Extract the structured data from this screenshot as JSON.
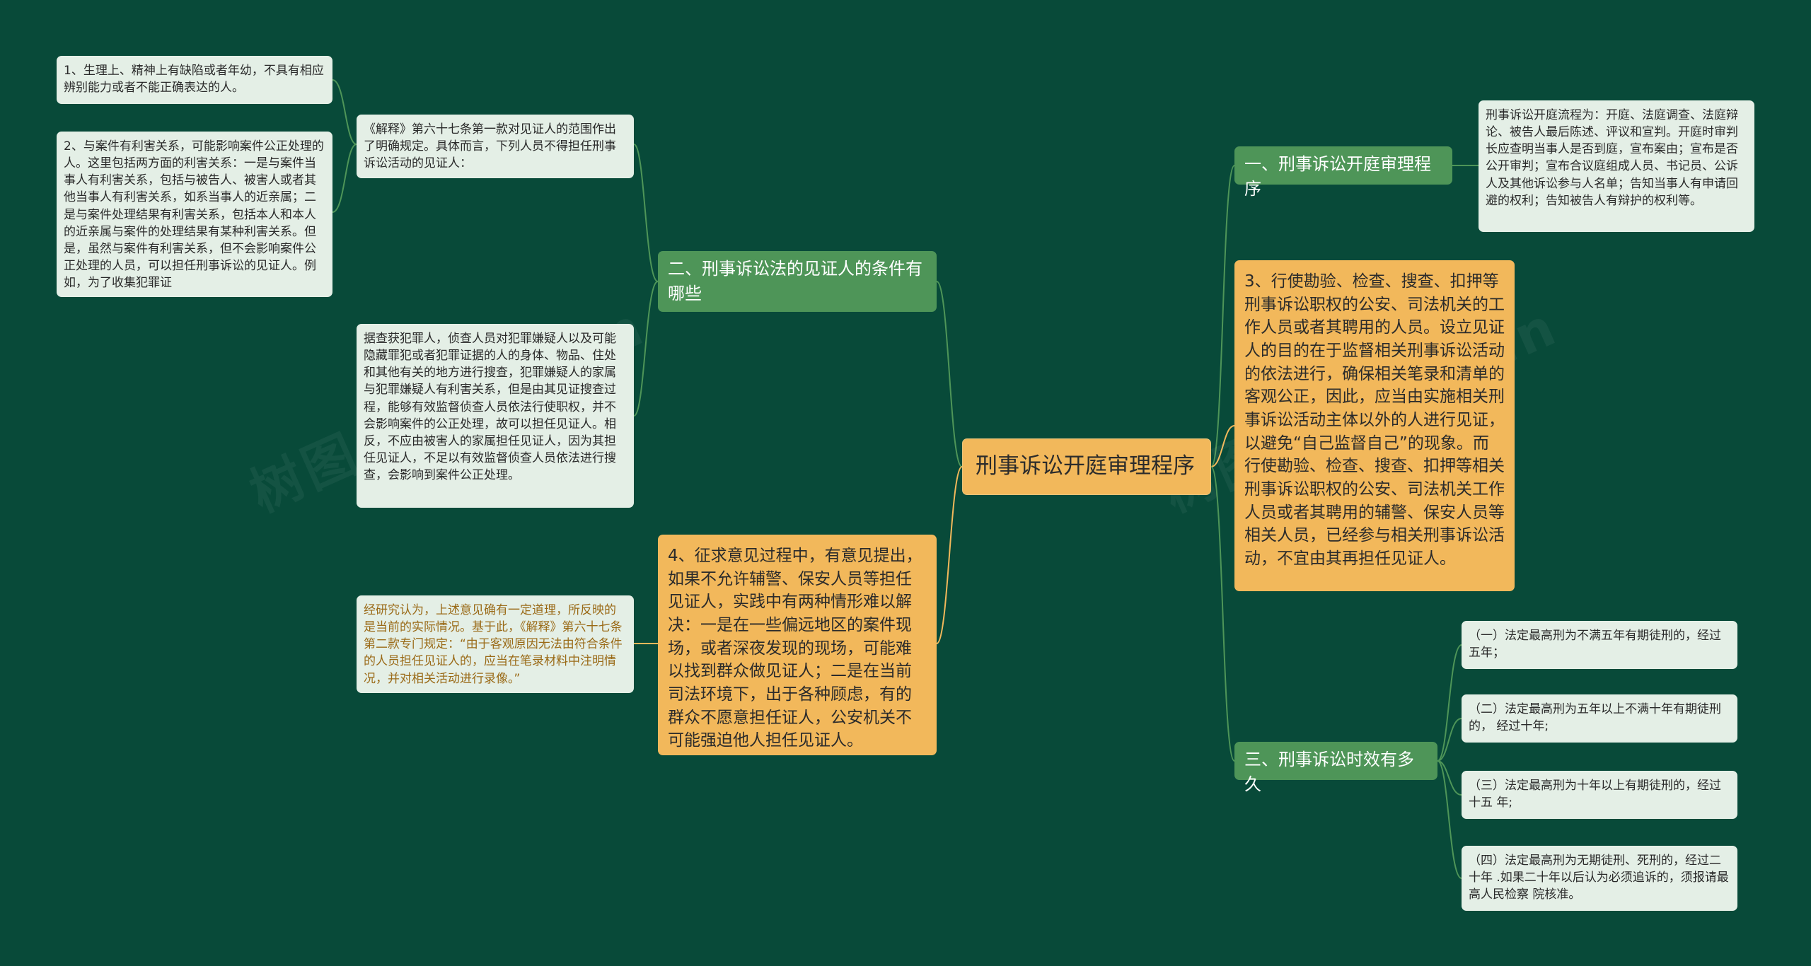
{
  "root": {
    "label": "刑事诉讼开庭审理程序"
  },
  "branches": {
    "b1": {
      "label": "一、刑事诉讼开庭审理程序"
    },
    "b2": {
      "label": "二、刑事诉讼法的见证人的条件有哪些"
    },
    "b3": {
      "label": "三、刑事诉讼时效有多久"
    },
    "b4": {
      "label": "3、行使勘验、检查、搜查、扣押等刑事诉讼职权的公安、司法机关的工作人员或者其聘用的人员。设立见证人的目的在于监督相关刑事诉讼活动的依法进行，确保相关笔录和清单的客观公正，因此，应当由实施相关刑事诉讼活动主体以外的人进行见证，以避免“自己监督自己”的现象。而行使勘验、检查、搜查、扣押等相关刑事诉讼职权的公安、司法机关工作人员或者其聘用的辅警、保安人员等相关人员，已经参与相关刑事诉讼活动，不宜由其再担任见证人。"
    },
    "b5": {
      "label": "4、征求意见过程中，有意见提出，如果不允许辅警、保安人员等担任见证人，实践中有两种情形难以解决：一是在一些偏远地区的案件现场，或者深夜发现的现场，可能难以找到群众做见证人；二是在当前司法环境下，出于各种顾虑，有的群众不愿意担任证人，公安机关不可能强迫他人担任见证人。"
    }
  },
  "leaves": {
    "procedure": "刑事诉讼开庭流程为：开庭、法庭调查、法庭辩论、被告人最后陈述、评议和宣判。开庭时审判长应查明当事人是否到庭，宣布案由；宣布是否公开审判；宣布合议庭组成人员、书记员、公诉人及其他诉讼参与人名单；告知当事人有申请回避的权利；告知被告人有辩护的权利等。",
    "explain": "《解释》第六十七条第一款对见证人的范围作出了明确规定。具体而言，下列人员不得担任刑事诉讼活动的见证人：",
    "item1": "1、生理上、精神上有缺陷或者年幼，不具有相应辨别能力或者不能正确表达的人。",
    "item2": "2、与案件有利害关系，可能影响案件公正处理的人。这里包括两方面的利害关系：一是与案件当事人有利害关系，包括与被告人、被害人或者其他当事人有利害关系，如系当事人的近亲属；二是与案件处理结果有利害关系，包括本人和本人的近亲属与案件的处理结果有某种利害关系。但是，虽然与案件有利害关系，但不会影响案件公正处理的人员，可以担任刑事诉讼的见证人。例如，为了收集犯罪证",
    "evidence": "据查获犯罪人，侦查人员对犯罪嫌疑人以及可能隐藏罪犯或者犯罪证据的人的身体、物品、住处和其他有关的地方进行搜查，犯罪嫌疑人的家属与犯罪嫌疑人有利害关系，但是由其见证搜查过程，能够有效监督侦查人员依法行使职权，并不会影响案件的公正处理，故可以担任见证人。相反，不应由被害人的家属担任见证人，因为其担任见证人，不足以有效监督侦查人员依法进行搜查，会影响到案件公正处理。",
    "research": "经研究认为，上述意见确有一定道理，所反映的是当前的实际情况。基于此，《解释》第六十七条第二款专门规定：“由于客观原因无法由符合条件的人员担任见证人的，应当在笔录材料中注明情况，并对相关活动进行录像。”",
    "limit1": "（一）法定最高刑为不满五年有期徒刑的，经过五年；",
    "limit2": "（二）法定最高刑为五年以上不满十年有期徒刑的， 经过十年;",
    "limit3": "（三）法定最高刑为十年以上有期徒刑的，经过十五 年;",
    "limit4": "（四）法定最高刑为无期徒刑、死刑的，经过二十年 .如果二十年以后认为必须追诉的，须报请最高人民检察 院核准。"
  },
  "colors": {
    "background": "#084a39",
    "root": "#f2b85b",
    "branch": "#4e9558",
    "leaf": "#e4efe6",
    "line_green": "#4e9558",
    "line_gold": "#f2b85b"
  }
}
